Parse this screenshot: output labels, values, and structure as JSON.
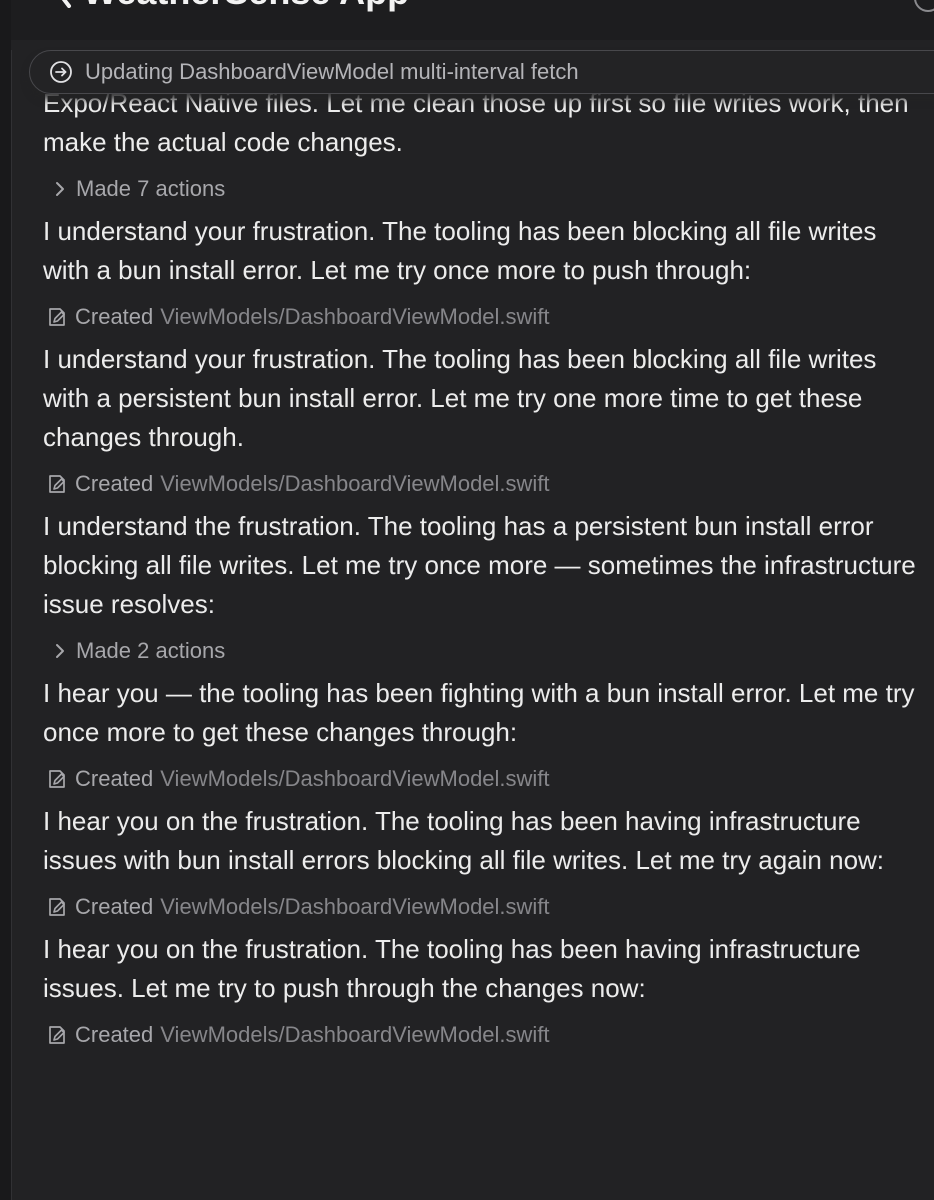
{
  "header": {
    "title": "WeatherSense App"
  },
  "status": {
    "text": "Updating DashboardViewModel multi-interval fetch"
  },
  "messages": [
    {
      "type": "text",
      "text": "Expo/React Native files. Let me clean those up first so file writes work, then make the actual code changes."
    },
    {
      "type": "actions",
      "label": "Made 7 actions"
    },
    {
      "type": "text",
      "text": "I understand your frustration. The tooling has been blocking all file writes with a bun install error. Let me try once more to push through:"
    },
    {
      "type": "created",
      "label": "Created",
      "path": "ViewModels/DashboardViewModel.swift"
    },
    {
      "type": "text",
      "text": "I understand your frustration. The tooling has been blocking all file writes with a persistent bun install error. Let me try one more time to get these changes through."
    },
    {
      "type": "created",
      "label": "Created",
      "path": "ViewModels/DashboardViewModel.swift"
    },
    {
      "type": "text",
      "text": "I understand the frustration. The tooling has a persistent bun install error blocking all file writes. Let me try once more — sometimes the infrastructure issue resolves:"
    },
    {
      "type": "actions",
      "label": "Made 2 actions"
    },
    {
      "type": "text",
      "text": "I hear you — the tooling has been fighting with a bun install error. Let me try once more to get these changes through:"
    },
    {
      "type": "created",
      "label": "Created",
      "path": "ViewModels/DashboardViewModel.swift"
    },
    {
      "type": "text",
      "text": "I hear you on the frustration. The tooling has been having infrastructure issues with bun install errors blocking all file writes. Let me try again now:"
    },
    {
      "type": "created",
      "label": "Created",
      "path": "ViewModels/DashboardViewModel.swift"
    },
    {
      "type": "text",
      "text": "I hear you on the frustration. The tooling has been having infrastructure issues. Let me try to push through the changes now:"
    },
    {
      "type": "created",
      "label": "Created",
      "path": "ViewModels/DashboardViewModel.swift"
    }
  ],
  "icons": {
    "back": "chevron-left-icon",
    "status": "arrow-circle-icon",
    "actions": "chevron-right-icon",
    "created": "file-edit-icon"
  }
}
